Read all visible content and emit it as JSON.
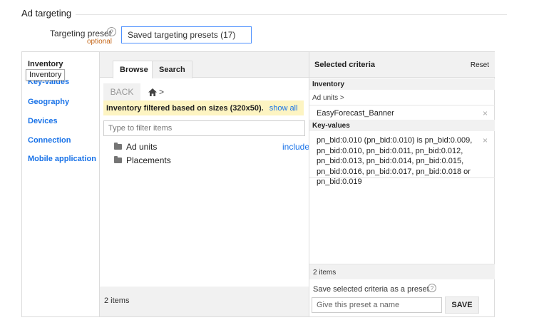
{
  "section": {
    "title": "Ad targeting"
  },
  "preset": {
    "label": "Targeting preset",
    "help_icon": "?",
    "optional": "optional",
    "value": "Saved targeting presets (17)"
  },
  "nav": {
    "items": [
      {
        "label": "Inventory"
      },
      {
        "label": "Key-values"
      },
      {
        "label": "Geography"
      },
      {
        "label": "Devices"
      },
      {
        "label": "Connection"
      },
      {
        "label": "Mobile application"
      }
    ],
    "tooltip": "Inventory"
  },
  "browse": {
    "tabs": [
      {
        "label": "Browse"
      },
      {
        "label": "Search"
      }
    ],
    "back_label": "BACK",
    "home_icon": "home-icon",
    "home_arrow": ">",
    "filter_note": "Inventory filtered based on sizes (320x50).",
    "show_all": "show all",
    "filter_placeholder": "Type to filter items",
    "tree": [
      {
        "label": "Ad units"
      },
      {
        "label": "Placements"
      }
    ],
    "include_label": "include",
    "count": "2 items"
  },
  "selected": {
    "title": "Selected criteria",
    "reset": "Reset",
    "inventory_head": "Inventory",
    "ad_units_path": "Ad units >",
    "ad_unit_value": "EasyForecast_Banner",
    "keyvalues_head": "Key-values",
    "keyvalues_text": "pn_bid:0.010 (pn_bid:0.010) is pn_bid:0.009, pn_bid:0.010, pn_bid:0.011, pn_bid:0.012, pn_bid:0.013, pn_bid:0.014, pn_bid:0.015, pn_bid:0.016, pn_bid:0.017, pn_bid:0.018 or pn_bid:0.019",
    "remove_icon": "×",
    "count": "2 items",
    "save_label": "Save selected criteria as a preset",
    "save_help_icon": "?",
    "save_placeholder": "Give this preset a name",
    "save_button": "SAVE"
  },
  "colors": {
    "accent": "#1a73e8",
    "optional": "#c5671a",
    "highlight": "#fdf4c2",
    "panel_bg": "#f1f1f1"
  }
}
